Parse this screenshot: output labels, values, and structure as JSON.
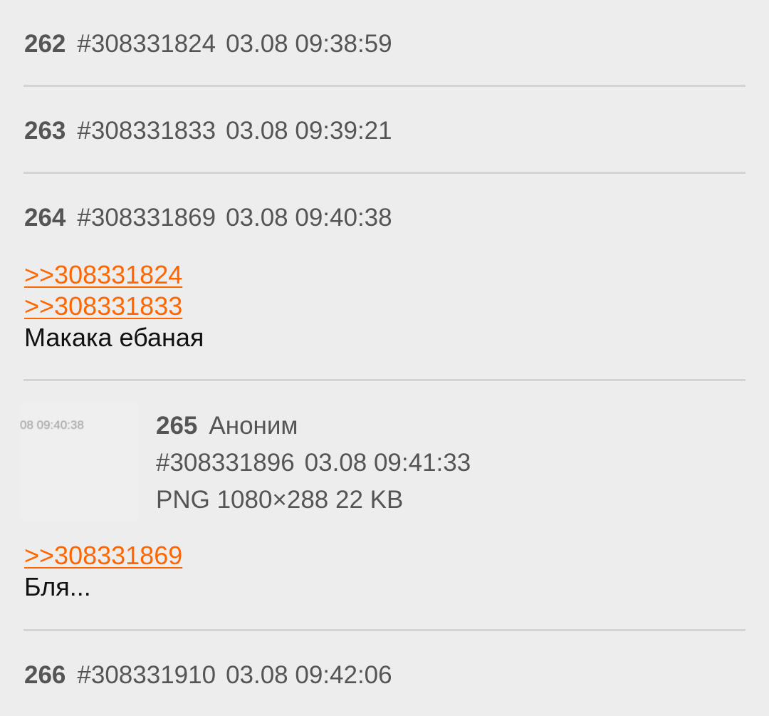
{
  "posts": [
    {
      "num": "262",
      "id": "#308331824",
      "date": "03.08 09:38:59"
    },
    {
      "num": "263",
      "id": "#308331833",
      "date": "03.08 09:39:21"
    },
    {
      "num": "264",
      "id": "#308331869",
      "date": "03.08 09:40:38",
      "replies": [
        ">>308331824",
        ">>308331833"
      ],
      "text": "Макака ебаная"
    },
    {
      "num": "265",
      "name": "Аноним",
      "id": "#308331896",
      "date": "03.08 09:41:33",
      "file_info": "PNG 1080×288 22 KB",
      "thumb_text": "08 09:40:38",
      "replies": [
        ">>308331869"
      ],
      "text": "Бля..."
    },
    {
      "num": "266",
      "id": "#308331910",
      "date": "03.08 09:42:06"
    }
  ],
  "colors": {
    "background": "#ededed",
    "divider": "#d4d4d4",
    "link": "#ff6600",
    "meta_text": "#555555",
    "body_text": "#111111"
  }
}
